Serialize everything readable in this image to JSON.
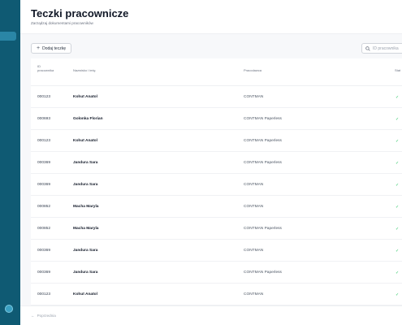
{
  "header": {
    "title": "Teczki pracownicze",
    "subtitle": "Zarządzaj dokumentami pracowników"
  },
  "toolbar": {
    "add_label": "Dodaj teczkę",
    "add_icon": "plus-icon",
    "search_placeholder": "ID pracownika",
    "search_icon": "search-icon"
  },
  "table": {
    "columns": {
      "id_line1": "ID",
      "id_line2": "pracownika",
      "name": "Nazwisko i imię",
      "employer": "Pracodawca",
      "status": "Stat"
    },
    "rows": [
      {
        "id": "000123",
        "name": "Kohut Anatol",
        "employer": "CONTMAN",
        "status": "✓"
      },
      {
        "id": "000693",
        "name": "Golonka Florian",
        "employer": "CONTMAN Paperless",
        "status": "✓"
      },
      {
        "id": "000123",
        "name": "Kohut Anatol",
        "employer": "CONTMAN Paperless",
        "status": "✓"
      },
      {
        "id": "000369",
        "name": "Jandura Sara",
        "employer": "CONTMAN Paperless",
        "status": "✓"
      },
      {
        "id": "000369",
        "name": "Jandura Sara",
        "employer": "CONTMAN",
        "status": "✓"
      },
      {
        "id": "000852",
        "name": "Macha Maryla",
        "employer": "CONTMAN",
        "status": "✓"
      },
      {
        "id": "000852",
        "name": "Macha Maryla",
        "employer": "CONTMAN Paperless",
        "status": "✓"
      },
      {
        "id": "000369",
        "name": "Jandura Sara",
        "employer": "CONTMAN",
        "status": "✓"
      },
      {
        "id": "000369",
        "name": "Jandura Sara",
        "employer": "CONTMAN Paperless",
        "status": "✓"
      },
      {
        "id": "000123",
        "name": "Kohut Anatol",
        "employer": "CONTMAN",
        "status": "✓"
      }
    ]
  },
  "pagination": {
    "prev_label": "Poprzednia",
    "prev_icon": "arrow-left-icon"
  },
  "colors": {
    "sidebar": "#0f5a73",
    "sidebar_active": "#2a86a6",
    "status_ok": "#22c55e"
  }
}
